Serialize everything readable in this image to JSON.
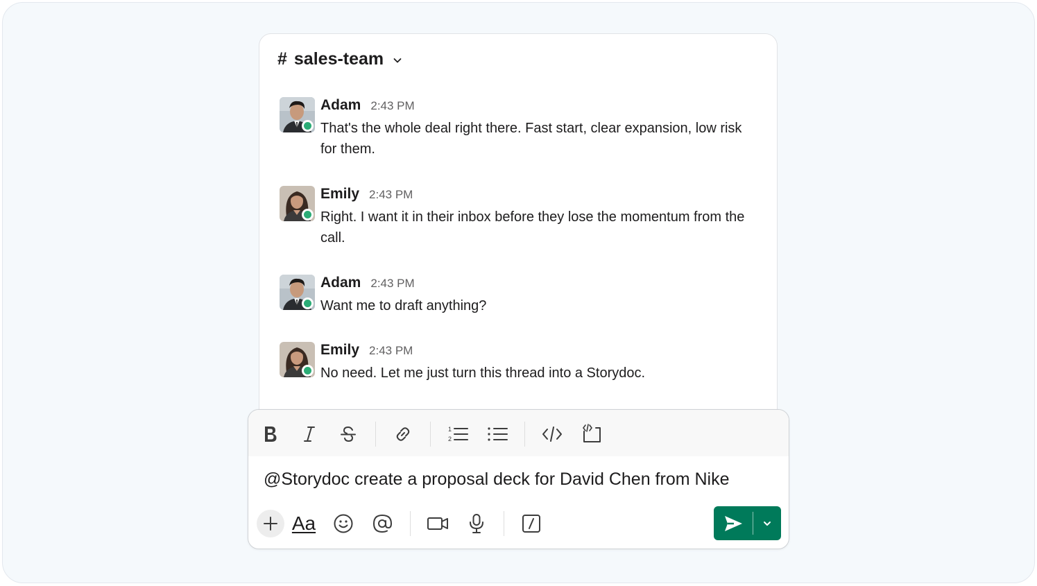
{
  "channel": {
    "hash": "#",
    "name": "sales-team"
  },
  "messages": [
    {
      "author": "Adam",
      "time": "2:43 PM",
      "text": "That's the whole deal right there. Fast start, clear expansion, low risk for them.",
      "presence": "online"
    },
    {
      "author": "Emily",
      "time": "2:43 PM",
      "text": "Right. I want it in their inbox before they lose the momentum from the call.",
      "presence": "online"
    },
    {
      "author": "Adam",
      "time": "2:43 PM",
      "text": "Want me to draft anything?",
      "presence": "online"
    },
    {
      "author": "Emily",
      "time": "2:43 PM",
      "text": "No need. Let me just turn this thread into a Storydoc.",
      "presence": "online"
    }
  ],
  "composer": {
    "input_value": "@Storydoc create a proposal deck for David Chen from Nike",
    "format_label": "Aa",
    "format_toolbar": [
      "bold-icon",
      "italic-icon",
      "strikethrough-icon",
      "link-icon",
      "ordered-list-icon",
      "bulleted-list-icon",
      "code-icon",
      "code-block-icon"
    ],
    "bottom_toolbar": [
      "plus-icon",
      "text-format-icon",
      "emoji-icon",
      "mention-icon",
      "video-icon",
      "microphone-icon",
      "slash-command-icon"
    ],
    "send_color": "#007a5a"
  },
  "colors": {
    "presence": "#2bac76",
    "send": "#007a5a",
    "background": "#f5f9fc"
  }
}
